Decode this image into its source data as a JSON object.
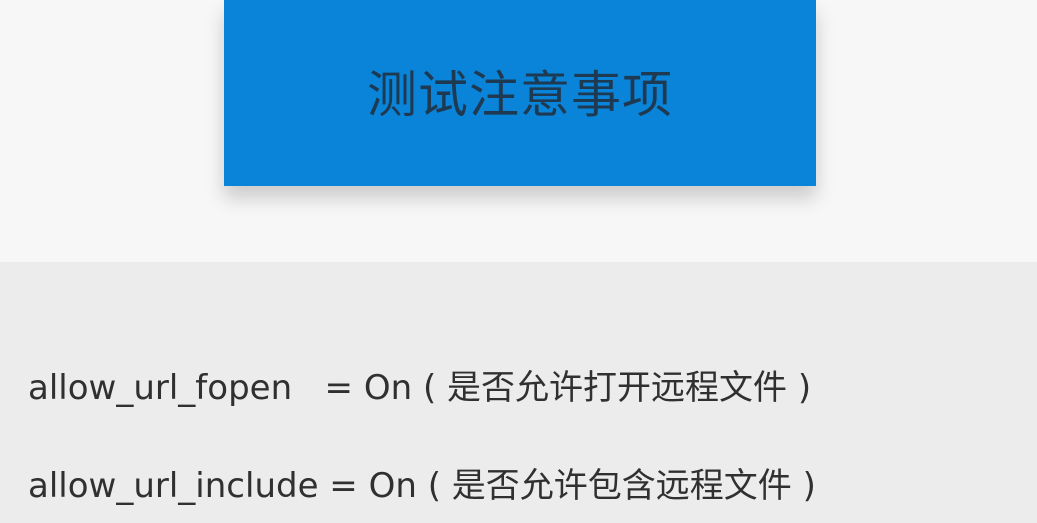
{
  "title": "测试注意事项",
  "lines": [
    "allow_url_fopen   = On ( 是否允许打开远程文件 )",
    "allow_url_include = On ( 是否允许包含远程文件 )"
  ],
  "colors": {
    "title_card": "#0a84d8",
    "page_background": "#f7f7f7",
    "content_background": "#ececec"
  }
}
